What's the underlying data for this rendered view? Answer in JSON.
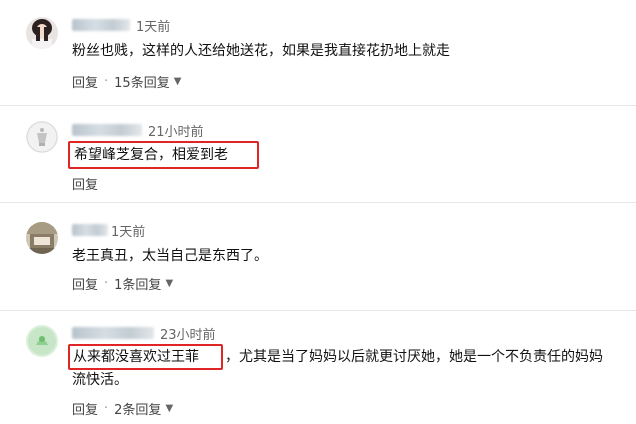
{
  "comments": [
    {
      "time": "1天前",
      "text": "粉丝也贱，这样的人还给她送花，如果是我直接花扔地上就走",
      "reply_label": "回复",
      "replies_label": "15条回复"
    },
    {
      "time": "21小时前",
      "text": "希望峰芝复合，相爱到老",
      "reply_label": "回复"
    },
    {
      "time": "1天前",
      "text": "老王真丑，太当自己是东西了。",
      "reply_label": "回复",
      "replies_label": "1条回复"
    },
    {
      "time": "23小时前",
      "text_highlight": "从来都没喜欢过王菲",
      "text_rest": "，尤其是当了妈妈以后就更讨厌她，她是一个不负责任的妈妈",
      "text_line2": "流快活。",
      "reply_label": "回复",
      "replies_label": "2条回复"
    }
  ],
  "colors": {
    "highlight_border": "#e02525",
    "separator": "#e6e6e6"
  },
  "icons": {
    "expand": "chevron-down-icon"
  }
}
